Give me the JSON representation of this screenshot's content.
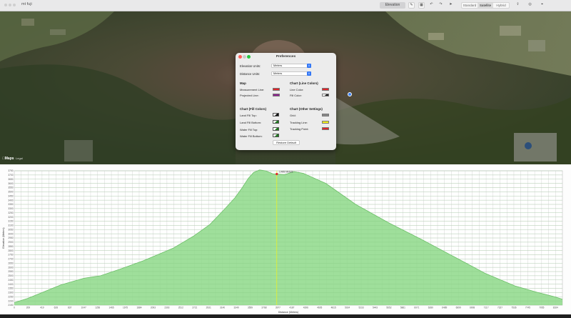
{
  "window": {
    "title": "mt fuji",
    "toolbar": {
      "elevation_button": "Elevation",
      "map_modes": [
        "Standard",
        "Satellite",
        "Hybrid"
      ],
      "active_mode": "Satellite"
    }
  },
  "map": {
    "logo": "Maps",
    "legal": "Legal"
  },
  "preferences": {
    "title": "Preferences",
    "elevation_units_label": "Elevation Units:",
    "elevation_units_value": "Meters",
    "distance_units_label": "Distance Units:",
    "distance_units_value": "Meters",
    "map_section": "Map",
    "measurement_line_label": "Measurement Line:",
    "measurement_line_color": "#e0262b",
    "projected_line_label": "Projected Line:",
    "projected_line_color": "#8e1f8f",
    "chart_line_section": "Chart (Line Colors)",
    "line_color_label": "Line Color:",
    "line_color": "#e0262b",
    "fill_color_label": "Fill Color:",
    "fill_color": "#222222",
    "chart_fill_section": "Chart (Fill Colors)",
    "land_fill_top_label": "Land Fill Top:",
    "land_fill_bottom_label": "Land Fill Bottom:",
    "water_fill_top_label": "Water Fill Top:",
    "water_fill_bottom_label": "Water Fill Bottom:",
    "chart_other_section": "Chart (Other Settings)",
    "grid_label": "Grid:",
    "grid_color": "#888888",
    "tracking_line_label": "Tracking Line:",
    "tracking_line_color": "#f2f21a",
    "tracking_point_label": "Tracking Point:",
    "tracking_point_color": "#e0262b",
    "restore_button": "Restore Default"
  },
  "chart_data": {
    "type": "area",
    "xlabel": "Distance (Meters)",
    "ylabel": "Elevation (Meters)",
    "ylim": [
      2150,
      3750
    ],
    "yticks": [
      2150,
      2200,
      2250,
      2300,
      2350,
      2400,
      2450,
      2500,
      2550,
      2600,
      2650,
      2700,
      2750,
      2800,
      2850,
      2900,
      2950,
      3000,
      3050,
      3100,
      3150,
      3200,
      3250,
      3300,
      3350,
      3400,
      3450,
      3500,
      3550,
      3600,
      3650,
      3700,
      3750
    ],
    "xticks": [
      "0",
      "105",
      "209",
      "314",
      "419",
      "523",
      "628",
      "733",
      "837",
      "942",
      "1047",
      "1151",
      "1256",
      "1361",
      "1465",
      "1570",
      "1675",
      "1779",
      "1884",
      "1989",
      "2093",
      "2198",
      "2303",
      "2407",
      "2512",
      "2617",
      "2721",
      "2826",
      "2931",
      "3035",
      "3140",
      "3245",
      "3349",
      "3454",
      "3559",
      "3663",
      "3768",
      "3873",
      "3977",
      "4082",
      "4187",
      "4291",
      "4396",
      "4501",
      "4605",
      "4710",
      "4815",
      "4919",
      "5024",
      "5129",
      "5233",
      "5338",
      "5443",
      "5547",
      "5652",
      "5757",
      "5861",
      "5966",
      "6071",
      "6175",
      "6280",
      "6385",
      "6489",
      "6594",
      "6699",
      "6803",
      "6908",
      "7013",
      "7117",
      "7222",
      "7327",
      "7431",
      "7536",
      "7641",
      "7745",
      "7850",
      "7955",
      "8059",
      "8164",
      "8269"
    ],
    "x": [
      0,
      200,
      420,
      700,
      1050,
      1300,
      1600,
      1950,
      2400,
      2700,
      2950,
      3180,
      3330,
      3440,
      3530,
      3610,
      3700,
      3790,
      3900,
      4080,
      4220,
      4360,
      4700,
      5150,
      5650,
      6150,
      6650,
      7100,
      7550,
      7900,
      8150,
      8269
    ],
    "y": [
      2180,
      2230,
      2300,
      2390,
      2470,
      2500,
      2580,
      2680,
      2830,
      2970,
      3110,
      3300,
      3430,
      3550,
      3660,
      3730,
      3760,
      3750,
      3715,
      3705,
      3740,
      3720,
      3600,
      3350,
      3130,
      2930,
      2720,
      2530,
      2380,
      2300,
      2250,
      2220
    ],
    "tracking_x": 3960,
    "tracking_label": "3,489 Meters",
    "fill_color": "#8ed98a",
    "line_color": "#6cbf68"
  }
}
